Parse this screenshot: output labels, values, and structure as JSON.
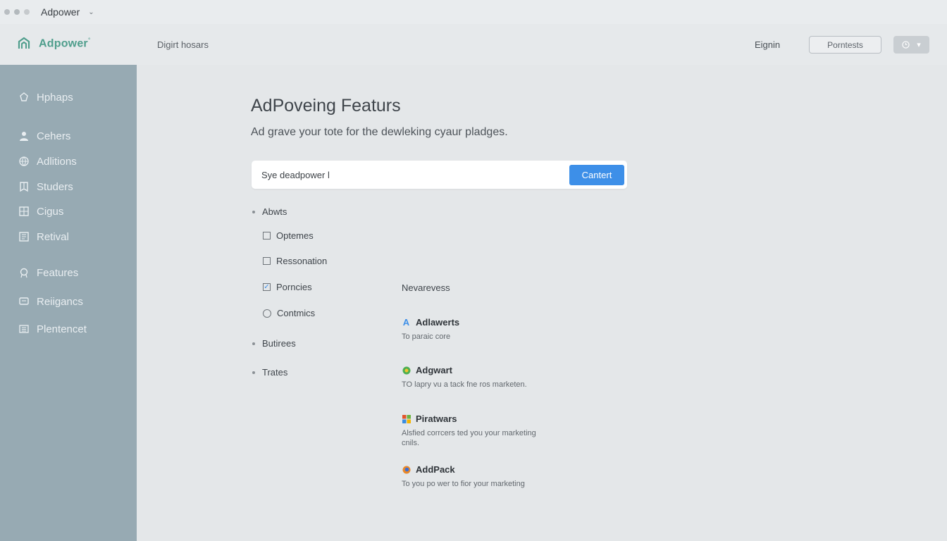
{
  "window": {
    "title": "Adpower"
  },
  "header": {
    "logo_text": "Adpower",
    "logo_mark": "°",
    "nav_text": "Digirt hosars",
    "signin": "Eignin",
    "button_label": "Porntests",
    "pill_icon": "clock-icon"
  },
  "sidebar": {
    "items": [
      {
        "label": "Hphaps",
        "icon": "gear-icon"
      },
      {
        "label": "Cehers",
        "icon": "user-icon"
      },
      {
        "label": "Adlitions",
        "icon": "globe-icon"
      },
      {
        "label": "Studers",
        "icon": "bookmark-icon"
      },
      {
        "label": "Cigus",
        "icon": "grid-icon"
      },
      {
        "label": "Retival",
        "icon": "document-icon"
      },
      {
        "label": "Features",
        "icon": "badge-icon"
      },
      {
        "label": "Reiigancs",
        "icon": "chat-icon"
      },
      {
        "label": "Plentencet",
        "icon": "list-icon"
      }
    ]
  },
  "main": {
    "title": "AdPoveing Featurs",
    "subtitle": "Ad grave your tote for the dewleking cyaur pladges.",
    "search": {
      "value": "Sye deadpower l",
      "button": "Cantert"
    },
    "options": {
      "group1": "Abwts",
      "items": [
        {
          "label": "Optemes",
          "type": "checkbox",
          "checked": false
        },
        {
          "label": "Ressonation",
          "type": "checkbox",
          "checked": false
        },
        {
          "label": "Porncies",
          "type": "checkbox",
          "checked": true
        },
        {
          "label": "Contmics",
          "type": "radio",
          "checked": false
        }
      ],
      "group2": "Butirees",
      "group3": "Trates"
    },
    "news": {
      "heading": "Nevarevess",
      "items": [
        {
          "title": "Adlawerts",
          "desc": "To paraic core",
          "icon": "letter-a-icon",
          "color": "#3d8fe8"
        },
        {
          "title": "Adgwart",
          "desc": "TO lapry vu a tack fne ros marketen.",
          "icon": "green-leaf-icon",
          "color": "#4caf50"
        },
        {
          "title": "Piratwars",
          "desc": "Alsfied corrcers ted you your marketing cnils.",
          "icon": "windows-icon",
          "color": "#e2552c"
        },
        {
          "title": "AddPack",
          "desc": "To you po wer to fior your marketing",
          "icon": "firefox-icon",
          "color": "#e8882a"
        }
      ]
    }
  },
  "colors": {
    "accent": "#3d8fe8",
    "brand": "#4f9e8c",
    "sidebar_bg": "#97aab3",
    "page_bg": "#e4e7e9"
  }
}
